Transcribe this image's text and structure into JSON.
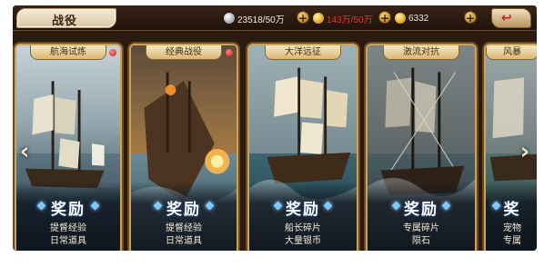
{
  "header": {
    "title": "战役",
    "silver": "23518/50万",
    "gold_capacity": "143万/50万",
    "gold": "6332",
    "plus_label": "+",
    "back_icon": "↩"
  },
  "cards": [
    {
      "label": "航海试炼",
      "reward_title": "奖励",
      "line1": "提督经验",
      "line2": "日常道具"
    },
    {
      "label": "经典战役",
      "reward_title": "奖励",
      "line1": "提督经验",
      "line2": "日常道具"
    },
    {
      "label": "大洋远征",
      "reward_title": "奖励",
      "line1": "船长碎片",
      "line2": "大量银币"
    },
    {
      "label": "激流对抗",
      "reward_title": "奖励",
      "line1": "专属碎片",
      "line2": "陨石"
    },
    {
      "label": "风暴",
      "reward_title": "奖",
      "line1": "宠物",
      "line2": "专属"
    }
  ],
  "nav": {
    "left": "‹",
    "right": "›"
  },
  "colors": {
    "accent_gold": "#c9a35a",
    "resource_red": "#e2352b",
    "frame_dark": "#2a1a10"
  }
}
